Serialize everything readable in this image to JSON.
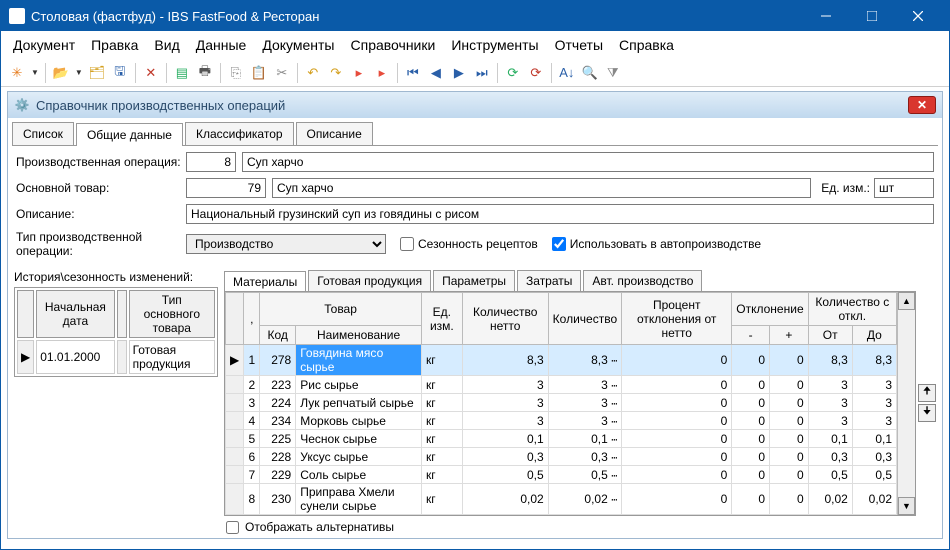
{
  "window": {
    "title": "Столовая (фастфуд) - IBS FastFood & Ресторан"
  },
  "menu": [
    "Документ",
    "Правка",
    "Вид",
    "Данные",
    "Документы",
    "Справочники",
    "Инструменты",
    "Отчеты",
    "Справка"
  ],
  "panel": {
    "title": "Справочник производственных операций"
  },
  "tabs1": [
    "Список",
    "Общие данные",
    "Классификатор",
    "Описание"
  ],
  "form": {
    "op_label": "Производственная операция:",
    "op_id": "8",
    "op_name": "Суп харчо",
    "prod_label": "Основной товар:",
    "prod_id": "79",
    "prod_name": "Суп харчо",
    "unit_label": "Ед. изм.:",
    "unit": "шт",
    "desc_label": "Описание:",
    "desc": "Национальный грузинский суп из говядины с рисом",
    "type_label": "Тип производственной операции:",
    "type_value": "Производство",
    "cb_season": "Сезонность рецептов",
    "cb_auto": "Использовать в автопроизводстве"
  },
  "history": {
    "title": "История\\сезонность изменений:",
    "cols": [
      "Начальная дата",
      "Тип основного товара"
    ],
    "row": {
      "date": "01.01.2000",
      "type": "Готовая продукция"
    }
  },
  "tabs2": [
    "Материалы",
    "Готовая продукция",
    "Параметры",
    "Затраты",
    "Авт. производство"
  ],
  "grid": {
    "hdr": {
      "tovar": "Товар",
      "ed": "Ед. изм.",
      "qn": "Количество нетто",
      "q": "Количество",
      "pct": "Процент отклонения от нетто",
      "dev": "Отклонение",
      "qd": "Количество с откл.",
      "code": "Код",
      "name": "Наименование",
      "minus": "-",
      "plus": "+",
      "from": "От",
      "to": "До"
    },
    "rows": [
      {
        "n": "1",
        "code": "278",
        "name": "Говядина мясо сырье",
        "u": "кг",
        "qn": "8,3",
        "q": "8,3",
        "p": "0",
        "dm": "0",
        "dp": "0",
        "f": "8,3",
        "t": "8,3"
      },
      {
        "n": "2",
        "code": "223",
        "name": "Рис сырье",
        "u": "кг",
        "qn": "3",
        "q": "3",
        "p": "0",
        "dm": "0",
        "dp": "0",
        "f": "3",
        "t": "3"
      },
      {
        "n": "3",
        "code": "224",
        "name": "Лук репчатый сырье",
        "u": "кг",
        "qn": "3",
        "q": "3",
        "p": "0",
        "dm": "0",
        "dp": "0",
        "f": "3",
        "t": "3"
      },
      {
        "n": "4",
        "code": "234",
        "name": "Морковь сырье",
        "u": "кг",
        "qn": "3",
        "q": "3",
        "p": "0",
        "dm": "0",
        "dp": "0",
        "f": "3",
        "t": "3"
      },
      {
        "n": "5",
        "code": "225",
        "name": "Чеснок сырье",
        "u": "кг",
        "qn": "0,1",
        "q": "0,1",
        "p": "0",
        "dm": "0",
        "dp": "0",
        "f": "0,1",
        "t": "0,1"
      },
      {
        "n": "6",
        "code": "228",
        "name": "Уксус сырье",
        "u": "кг",
        "qn": "0,3",
        "q": "0,3",
        "p": "0",
        "dm": "0",
        "dp": "0",
        "f": "0,3",
        "t": "0,3"
      },
      {
        "n": "7",
        "code": "229",
        "name": "Соль сырье",
        "u": "кг",
        "qn": "0,5",
        "q": "0,5",
        "p": "0",
        "dm": "0",
        "dp": "0",
        "f": "0,5",
        "t": "0,5"
      },
      {
        "n": "8",
        "code": "230",
        "name": "Приправа Хмели сунели сырье",
        "u": "кг",
        "qn": "0,02",
        "q": "0,02",
        "p": "0",
        "dm": "0",
        "dp": "0",
        "f": "0,02",
        "t": "0,02"
      }
    ]
  },
  "alt_cb": "Отображать альтернативы"
}
